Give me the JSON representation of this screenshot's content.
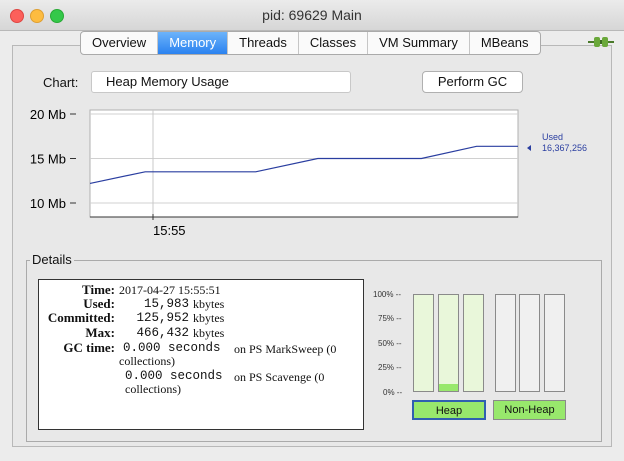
{
  "window": {
    "title": "pid: 69629 Main"
  },
  "tabs": [
    "Overview",
    "Memory",
    "Threads",
    "Classes",
    "VM Summary",
    "MBeans"
  ],
  "active_tab": "Memory",
  "chart_select": {
    "label": "Chart:",
    "value": "Heap Memory Usage"
  },
  "gc_button": "Perform GC",
  "colors": {
    "line": "#2a3ea0",
    "bar_fill": "#98e86c",
    "tab_active": "#2a82f0"
  },
  "chart_data": {
    "type": "line",
    "y_ticks": [
      "20 Mb",
      "15 Mb",
      "10 Mb"
    ],
    "ylim": [
      10,
      20
    ],
    "x_tick_label": "15:55",
    "series": [
      {
        "name": "Used",
        "x": [
          0,
          1.6,
          4.8,
          6.6,
          9.6,
          11.2,
          12.4
        ],
        "values": [
          12.2,
          13.5,
          13.5,
          15.0,
          15.0,
          16.37,
          16.37
        ]
      }
    ],
    "current_label": "Used",
    "current_value": "16,367,256"
  },
  "details": {
    "title": "Details",
    "time_label": "Time:",
    "time_value": "2017-04-27 15:55:51",
    "used_label": "Used:",
    "used_value": "15,983",
    "used_unit": "kbytes",
    "committed_label": "Committed:",
    "committed_value": "125,952",
    "committed_unit": "kbytes",
    "max_label": "Max:",
    "max_value": "466,432",
    "max_unit": "kbytes",
    "gc_label": "GC time:",
    "gc1_value": "0.000 seconds",
    "gc1_text": "on PS MarkSweep (0",
    "gc1_text2": "collections)",
    "gc2_value": "0.000 seconds",
    "gc2_text": "on PS Scavenge (0",
    "gc2_text2": "collections)"
  },
  "bars": {
    "axis": [
      "100% --",
      "75% --",
      "50% --",
      "25% --",
      "0% --"
    ],
    "heap_fill": [
      0,
      0.07,
      0
    ],
    "nonheap_fill": [
      0,
      0,
      0
    ],
    "heap_label": "Heap",
    "nonheap_label": "Non-Heap"
  }
}
